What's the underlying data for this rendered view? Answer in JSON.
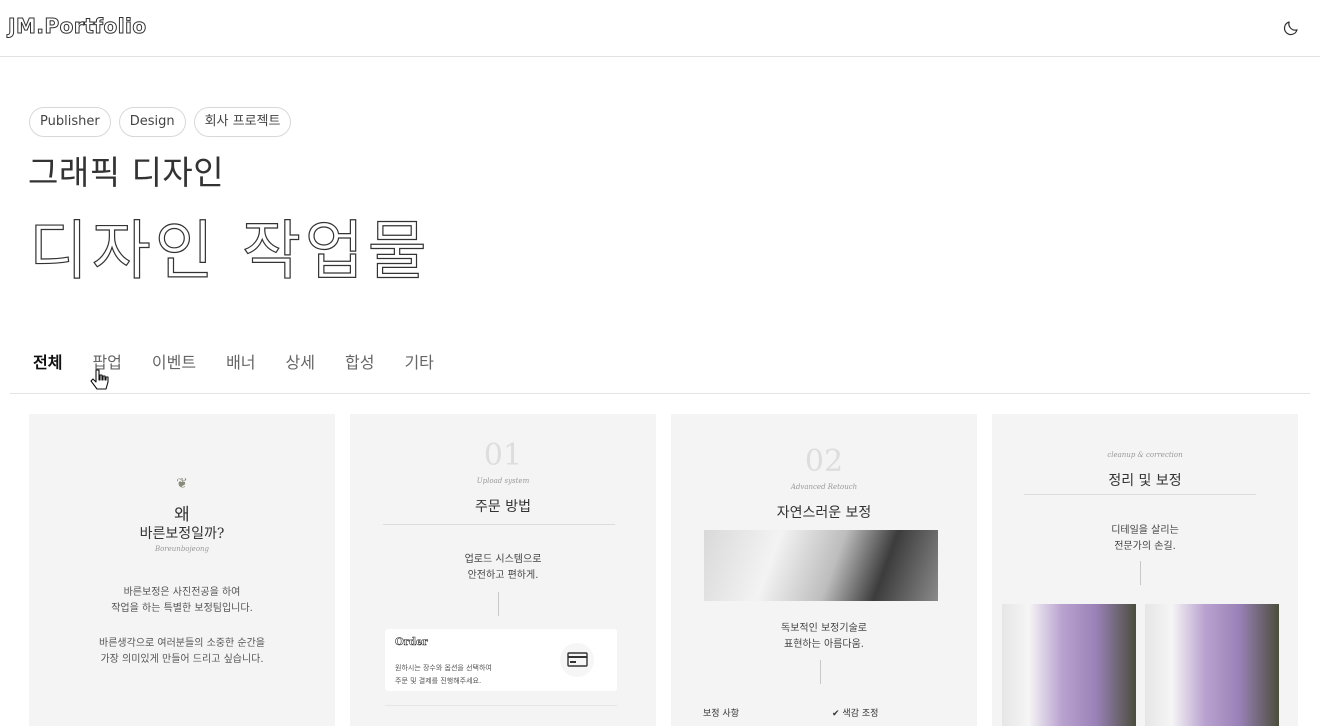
{
  "header": {
    "logo": "JM.Portfolio",
    "theme_icon": "moon-icon"
  },
  "hero": {
    "tags": [
      "Publisher",
      "Design",
      "회사 프로젝트"
    ],
    "subtitle": "그래픽 디자인",
    "title": "디자인 작업물"
  },
  "filters": {
    "tabs": [
      "전체",
      "팝업",
      "이벤트",
      "배너",
      "상세",
      "합성",
      "기타"
    ],
    "active": "전체"
  },
  "cards": [
    {
      "heading": "왜",
      "title": "바른보정일까?",
      "script": "Boreunbojeong",
      "body1_line1": "바른보정은 사진전공을 하여",
      "body1_line2": "작업을 하는 특별한 보정팀입니다.",
      "body2_line1": "바른생각으로 여러분들의 소중한 순간을",
      "body2_line2": "가장 의미있게 만들어 드리고 싶습니다."
    },
    {
      "number": "01",
      "script": "Upload system",
      "title": "주문 방법",
      "body_line1": "업로드 시스템으로",
      "body_line2": "안전하고 편하게.",
      "box_label": "Order",
      "box_line1": "원하시는 장수와 옵션을 선택하여",
      "box_line2": "주문 및 결제를 진행해주세요."
    },
    {
      "number": "02",
      "script": "Advanced Retouch",
      "title": "자연스러운 보정",
      "body_line1": "독보적인 보정기술로",
      "body_line2": "표현하는 아름다움.",
      "footer_left": "보정 사항",
      "footer_right": "색감 조정"
    },
    {
      "script": "cleanup & correction",
      "title": "정리 및 보정",
      "body_line1": "디테일을 살리는",
      "body_line2": "전문가의 손길."
    }
  ]
}
